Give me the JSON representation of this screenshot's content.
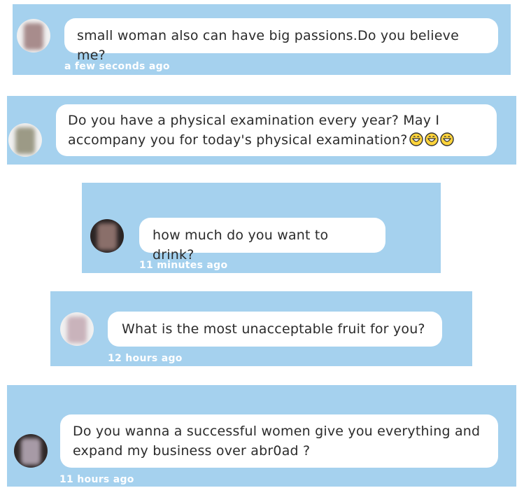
{
  "messages": [
    {
      "text": "small woman also can have big passions.Do you believe me?",
      "time": "a few seconds ago",
      "avatar_color": "#a88c8c"
    },
    {
      "text": "Do you have a physical examination every year? May I accompany you for today's physical examination?",
      "emojis": [
        "grinning-face",
        "grinning-face",
        "grinning-face"
      ],
      "time": "",
      "avatar_color": "#9c9a86"
    },
    {
      "text": "how much do you want to drink?",
      "time": "11 minutes ago",
      "avatar_color": "#6a5650"
    },
    {
      "text": "What is the most unacceptable fruit for you?",
      "time": "12 hours ago",
      "avatar_color": "#c9b3bb"
    },
    {
      "text": "Do you wanna a successful women give you everything and expand my business over abr0ad ?",
      "time": "11 hours ago",
      "avatar_color": "#a79aa6"
    }
  ],
  "colors": {
    "card_background": "#a5d1ee",
    "bubble_background": "#ffffff",
    "timestamp": "#ffffff"
  }
}
